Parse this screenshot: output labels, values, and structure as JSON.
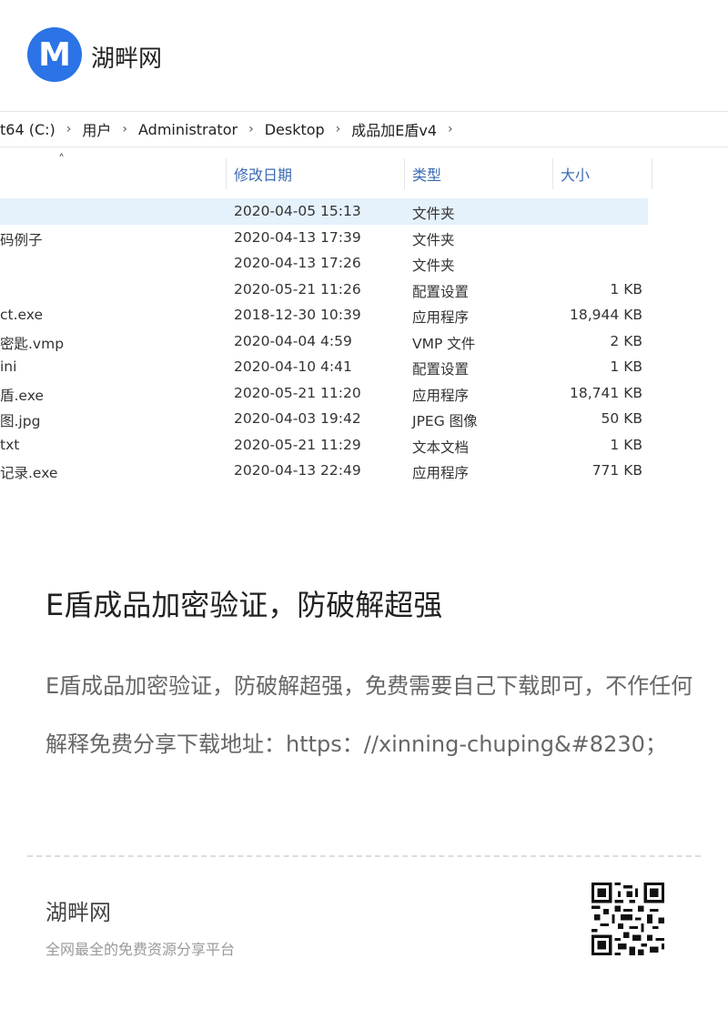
{
  "header": {
    "logo_letter": "M",
    "site_name": "湖畔网"
  },
  "explorer": {
    "breadcrumb": [
      "t64 (C:)",
      "用户",
      "Administrator",
      "Desktop",
      "成品加E盾v4"
    ],
    "columns": {
      "date": "修改日期",
      "type": "类型",
      "size": "大小"
    },
    "files": [
      {
        "name": "",
        "date": "2020-04-05 15:13",
        "type": "文件夹",
        "size": ""
      },
      {
        "name": "码例子",
        "date": "2020-04-13 17:39",
        "type": "文件夹",
        "size": ""
      },
      {
        "name": "",
        "date": "2020-04-13 17:26",
        "type": "文件夹",
        "size": ""
      },
      {
        "name": "",
        "date": "2020-05-21 11:26",
        "type": "配置设置",
        "size": "1 KB"
      },
      {
        "name": "ct.exe",
        "date": "2018-12-30 10:39",
        "type": "应用程序",
        "size": "18,944 KB"
      },
      {
        "name": "密匙.vmp",
        "date": "2020-04-04 4:59",
        "type": "VMP 文件",
        "size": "2 KB"
      },
      {
        "name": "ini",
        "date": "2020-04-10 4:41",
        "type": "配置设置",
        "size": "1 KB"
      },
      {
        "name": "盾.exe",
        "date": "2020-05-21 11:20",
        "type": "应用程序",
        "size": "18,741 KB"
      },
      {
        "name": "图.jpg",
        "date": "2020-04-03 19:42",
        "type": "JPEG 图像",
        "size": "50 KB"
      },
      {
        "name": "txt",
        "date": "2020-05-21 11:29",
        "type": "文本文档",
        "size": "1 KB"
      },
      {
        "name": "记录.exe",
        "date": "2020-04-13 22:49",
        "type": "应用程序",
        "size": "771 KB"
      }
    ]
  },
  "article": {
    "title": "E盾成品加密验证，防破解超强",
    "description": "E盾成品加密验证，防破解超强，免费需要自己下载即可，不作任何解释免费分享下载地址：https：//xinning-chuping&#8230；"
  },
  "footer": {
    "site_name": "湖畔网",
    "tagline": "全网最全的免费资源分享平台"
  },
  "colors": {
    "brand": "#2b73e6",
    "selection": "#e5f1fb",
    "header_text": "#3a6bb3"
  }
}
